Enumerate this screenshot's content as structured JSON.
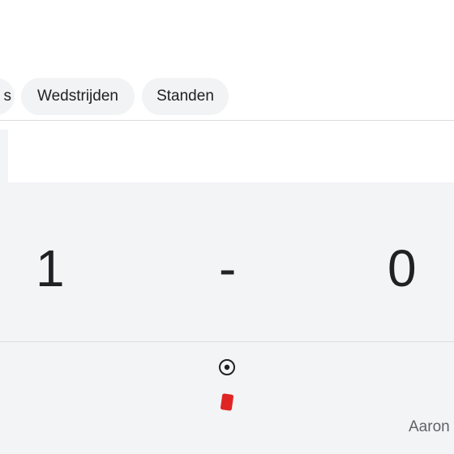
{
  "tabs": {
    "partial_label": "s",
    "matches_label": "Wedstrijden",
    "standings_label": "Standen"
  },
  "score": {
    "home": "1",
    "separator": "-",
    "away": "0"
  },
  "events": {
    "icons": [
      "goal-ball-icon",
      "red-card-icon"
    ],
    "player_name": "Aaron"
  },
  "colors": {
    "chip_bg": "#f1f3f4",
    "panel_bg": "#f3f4f6",
    "red_card": "#e02424"
  }
}
